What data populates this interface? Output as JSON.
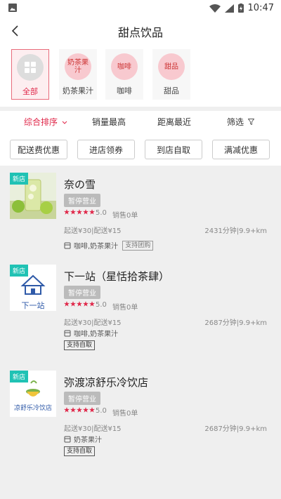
{
  "status_bar": {
    "time": "10:47"
  },
  "header": {
    "title": "甜点饮品"
  },
  "categories": [
    {
      "circle": "",
      "label": "全部"
    },
    {
      "circle": "奶茶果汁",
      "label": "奶茶果汁"
    },
    {
      "circle": "咖啡",
      "label": "咖啡"
    },
    {
      "circle": "甜品",
      "label": "甜品"
    }
  ],
  "sort_options": [
    "综合排序",
    "销量最高",
    "距离最近",
    "筛选"
  ],
  "filter_buttons": [
    "配送费优惠",
    "进店领券",
    "到店自取",
    "满减优惠"
  ],
  "shops": [
    {
      "badge": "新店",
      "name": "奈の雪",
      "status": "暂停营业",
      "rating": "5.0",
      "sold": "销售0单",
      "fees": "起送¥30|配送¥15",
      "distance": "2431分钟|9.9+km",
      "categories": "咖啡,奶茶果汁",
      "tag": "支持团购"
    },
    {
      "badge": "新店",
      "name": "下一站（星恬拾茶肆）",
      "status": "暂停营业",
      "rating": "5.0",
      "sold": "销售0单",
      "fees": "起送¥30|配送¥15",
      "distance": "2687分钟|9.9+km",
      "categories": "咖啡,奶茶果汁",
      "tag": "支持自取",
      "logo_text": "下一站"
    },
    {
      "badge": "新店",
      "name": "弥渡凉舒乐冷饮店",
      "status": "暂停营业",
      "rating": "5.0",
      "sold": "销售0单",
      "fees": "起送¥30|配送¥15",
      "distance": "2687分钟|9.9+km",
      "categories": "奶茶果汁",
      "tag": "支持自取",
      "logo_text": "凉舒乐冷饮店"
    }
  ],
  "colors": {
    "accent": "#e0284a",
    "badge": "#20c2b4",
    "star": "#e0284a"
  }
}
